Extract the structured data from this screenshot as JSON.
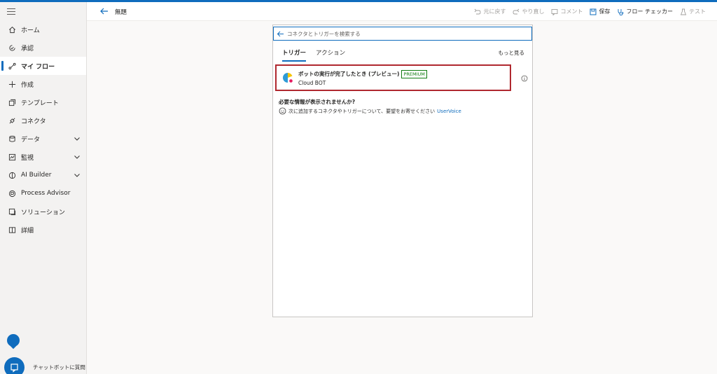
{
  "header": {
    "title": "無題",
    "toolbar": {
      "undo": "元に戻す",
      "redo": "やり直し",
      "comment": "コメント",
      "save": "保存",
      "flow_checker": "フロー チェッカー",
      "test": "テスト"
    }
  },
  "sidebar": {
    "items": [
      {
        "label": "ホーム",
        "icon": "home-icon"
      },
      {
        "label": "承認",
        "icon": "approvals-icon"
      },
      {
        "label": "マイ フロー",
        "icon": "flow-icon",
        "active": true
      },
      {
        "label": "作成",
        "icon": "plus-icon"
      },
      {
        "label": "テンプレート",
        "icon": "template-icon"
      },
      {
        "label": "コネクタ",
        "icon": "connector-icon"
      },
      {
        "label": "データ",
        "icon": "database-icon",
        "expandable": true
      },
      {
        "label": "監視",
        "icon": "monitor-icon",
        "expandable": true
      },
      {
        "label": "AI Builder",
        "icon": "ai-builder-icon",
        "expandable": true
      },
      {
        "label": "Process Advisor",
        "icon": "process-advisor-icon"
      },
      {
        "label": "ソリューション",
        "icon": "solution-icon"
      },
      {
        "label": "詳細",
        "icon": "book-icon"
      }
    ],
    "chatbot_label": "チャットボットに質問"
  },
  "panel": {
    "search_placeholder": "コネクタとトリガーを検索する",
    "tabs": [
      "トリガー",
      "アクション"
    ],
    "active_tab": "トリガー",
    "see_more": "もっと見る",
    "trigger": {
      "title": "ボットの実行が完了したとき (プレビュー)",
      "badge": "PREMIUM",
      "subtitle": "Cloud BOT"
    },
    "missing_title": "必要な情報が表示されませんか?",
    "feedback_text": "次に追加するコネクタやトリガーについて、要望をお寄せください",
    "feedback_link": "UserVoice"
  },
  "colors": {
    "accent": "#0f6cbd",
    "highlight_border": "#b0282f",
    "premium": "#107c10"
  }
}
